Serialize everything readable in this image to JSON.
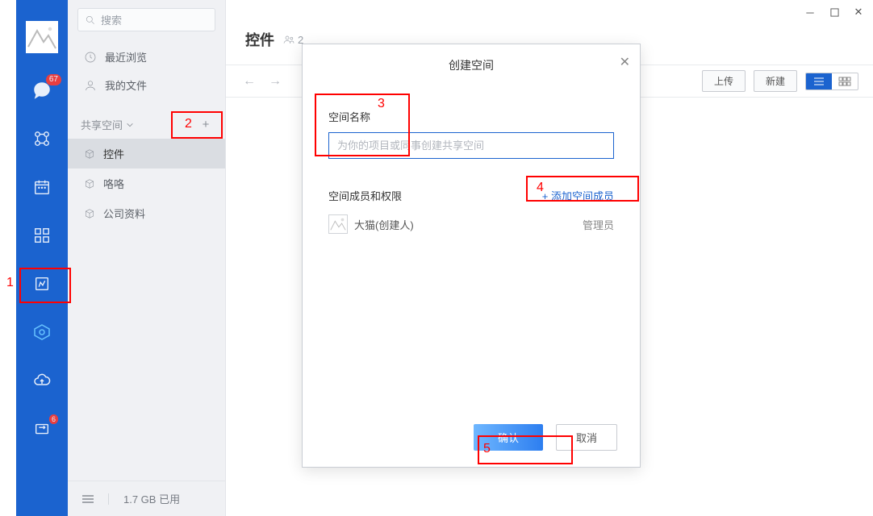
{
  "rail": {
    "notification_badge": "67",
    "share_badge": "6"
  },
  "sidebar": {
    "search_placeholder": "搜索",
    "recent_label": "最近浏览",
    "myfiles_label": "我的文件",
    "section_label": "共享空间",
    "spaces": [
      {
        "label": "控件"
      },
      {
        "label": "咯咯"
      },
      {
        "label": "公司资料"
      }
    ],
    "storage_text": "1.7 GB 已用"
  },
  "header": {
    "title": "控件",
    "people_count": "2"
  },
  "toolbar": {
    "upload_label": "上传",
    "new_label": "新建"
  },
  "dialog": {
    "title": "创建空间",
    "name_label": "空间名称",
    "name_placeholder": "为你的项目或同事创建共享空间",
    "members_label": "空间成员和权限",
    "add_member_label": "+ 添加空间成员",
    "member_name": "大猫(创建人)",
    "member_role": "管理员",
    "confirm_label": "确认",
    "cancel_label": "取消"
  },
  "callouts": {
    "n1": "1",
    "n2": "2",
    "n3": "3",
    "n4": "4",
    "n5": "5"
  }
}
